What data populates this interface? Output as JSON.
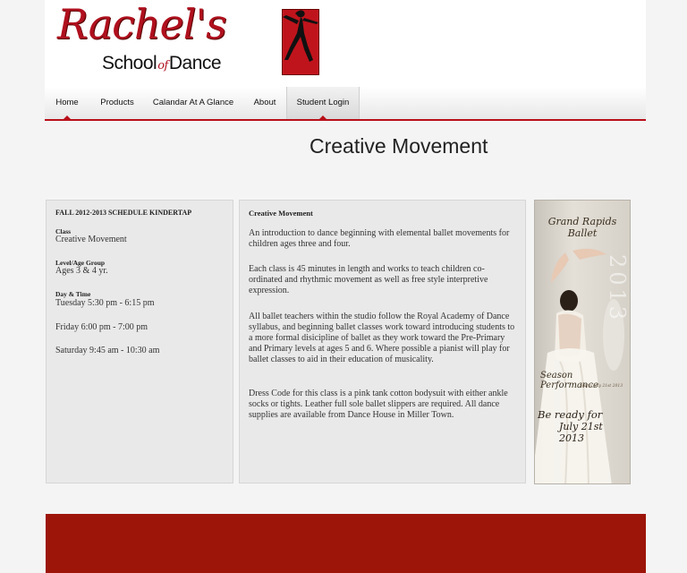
{
  "brand": {
    "script": "Rachel's",
    "sub_left": "School",
    "sub_of": "of",
    "sub_right": "Dance",
    "accent_color": "#b0101e"
  },
  "nav": {
    "items": [
      {
        "label": "Home",
        "active": true
      },
      {
        "label": "Products"
      },
      {
        "label": "Calandar At A Glance"
      },
      {
        "label": "About"
      },
      {
        "label": "Student Login"
      }
    ]
  },
  "page": {
    "title": "Creative Movement"
  },
  "schedule": {
    "heading": "FALL 2012-2013 SCHEDULE KINDERTAP",
    "class_label": "Class",
    "class_value": "Creative Movement",
    "age_label": "Level/Age Group",
    "age_value": "Ages 3 & 4 yr.",
    "time_label": "Day & Time",
    "times": [
      "Tuesday 5:30 pm - 6:15 pm",
      "Friday 6:00 pm - 7:00 pm",
      "Saturday 9:45 am - 10:30 am"
    ]
  },
  "description": {
    "heading": "Creative Movement",
    "paragraphs": [
      "An introduction to dance beginning with elemental ballet movements for children ages three and four.",
      "Each class is 45 minutes in length and works to teach children co-ordinated and rhythmic movement as well as free style interpretive expression.",
      "All ballet teachers within the studio follow the Royal Academy of Dance syllabus, and beginning ballet classes work toward introducing students to a more formal disicipline of ballet as they work toward the Pre-Primary and Primary levels at ages 5 and 6. Where possible a pianist will play for ballet classes to aid in their education of musicality.",
      "Dress Code for this class is a pink tank cotton bodysuit with either ankle socks or tights. Leather full sole ballet slippers are required. All dance supplies are available from Dance House in Miller Town."
    ]
  },
  "poster": {
    "title": "Grand Rapids Ballet",
    "year": "2013",
    "season": "Season Performance",
    "starts": "Starts July 21st 2013",
    "ready": "Be ready for",
    "date": "July 21st 2013"
  },
  "footer": {
    "color": "#9d1409"
  }
}
